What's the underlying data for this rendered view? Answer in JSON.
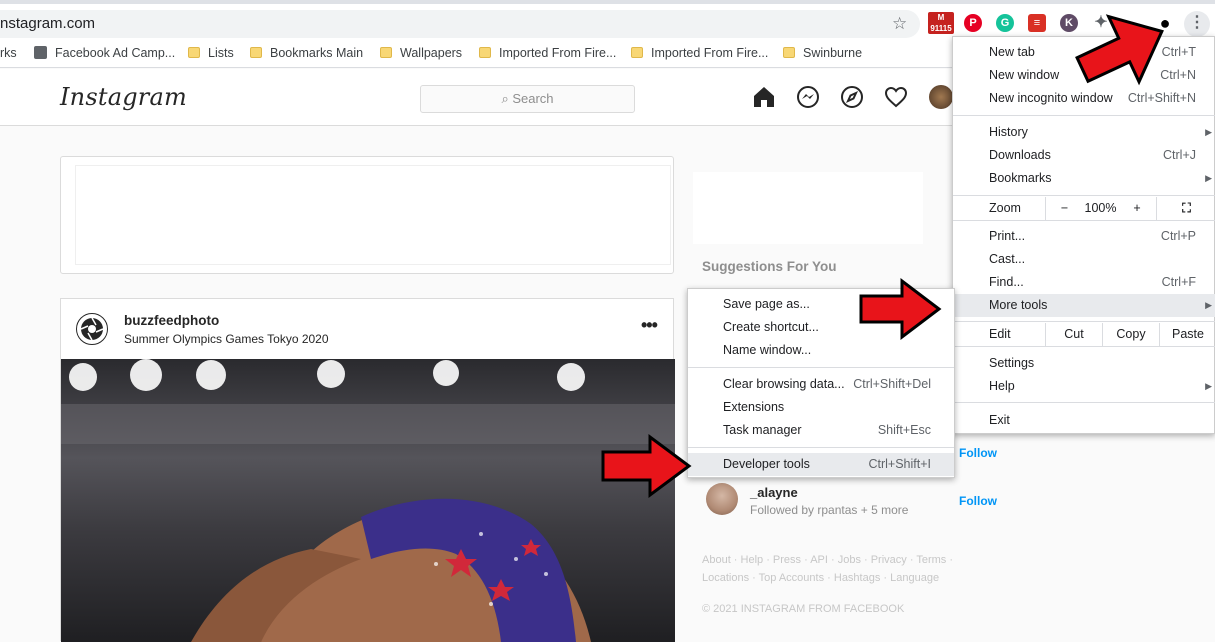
{
  "browser": {
    "url": "nstagram.com",
    "bookmarks": [
      {
        "label": "rks",
        "type": "partial"
      },
      {
        "label": "Facebook Ad Camp...",
        "type": "page"
      },
      {
        "label": "Lists",
        "type": "folder"
      },
      {
        "label": "Bookmarks Main",
        "type": "folder"
      },
      {
        "label": "Wallpapers",
        "type": "folder"
      },
      {
        "label": "Imported From Fire...",
        "type": "folder"
      },
      {
        "label": "Imported From Fire...",
        "type": "folder"
      },
      {
        "label": "Swinburne",
        "type": "folder"
      }
    ],
    "ext_badge": "91115",
    "kebab_icon": "⋮"
  },
  "instagram": {
    "logo": "Instagram",
    "search_placeholder": "Search",
    "post": {
      "username": "buzzfeedphoto",
      "location": "Summer Olympics Games Tokyo 2020",
      "more": "•••"
    },
    "sidebar": {
      "suggestions_title": "Suggestions For You",
      "follow_1": "Follow",
      "suggestion_name": "_alayne",
      "suggestion_sub": "Followed by rpantas + 5 more",
      "follow_2": "Follow",
      "footer_links": "About · Help · Press · API · Jobs · Privacy · Terms · Locations · Top Accounts · Hashtags · Language",
      "copyright": "© 2021 INSTAGRAM FROM FACEBOOK"
    }
  },
  "chrome_menu": {
    "new_tab": "New tab",
    "new_tab_sc": "Ctrl+T",
    "new_window": "New window",
    "new_window_sc": "Ctrl+N",
    "new_incognito": "New incognito window",
    "new_incognito_sc": "Ctrl+Shift+N",
    "history": "History",
    "downloads": "Downloads",
    "downloads_sc": "Ctrl+J",
    "bookmarks": "Bookmarks",
    "zoom": "Zoom",
    "zoom_minus": "−",
    "zoom_level": "100%",
    "zoom_plus": "+",
    "print": "Print...",
    "print_sc": "Ctrl+P",
    "cast": "Cast...",
    "find": "Find...",
    "find_sc": "Ctrl+F",
    "more_tools": "More tools",
    "edit": "Edit",
    "cut": "Cut",
    "copy": "Copy",
    "paste": "Paste",
    "settings": "Settings",
    "help": "Help",
    "exit": "Exit"
  },
  "more_tools_menu": {
    "save_page": "Save page as...",
    "create_shortcut": "Create shortcut...",
    "name_window": "Name window...",
    "clear_data": "Clear browsing data...",
    "clear_data_sc": "Ctrl+Shift+Del",
    "extensions": "Extensions",
    "task_manager": "Task manager",
    "task_manager_sc": "Shift+Esc",
    "dev_tools": "Developer tools",
    "dev_tools_sc": "Ctrl+Shift+I"
  },
  "colors": {
    "arrow_red": "#e8141a",
    "follow_blue": "#0095f6"
  }
}
